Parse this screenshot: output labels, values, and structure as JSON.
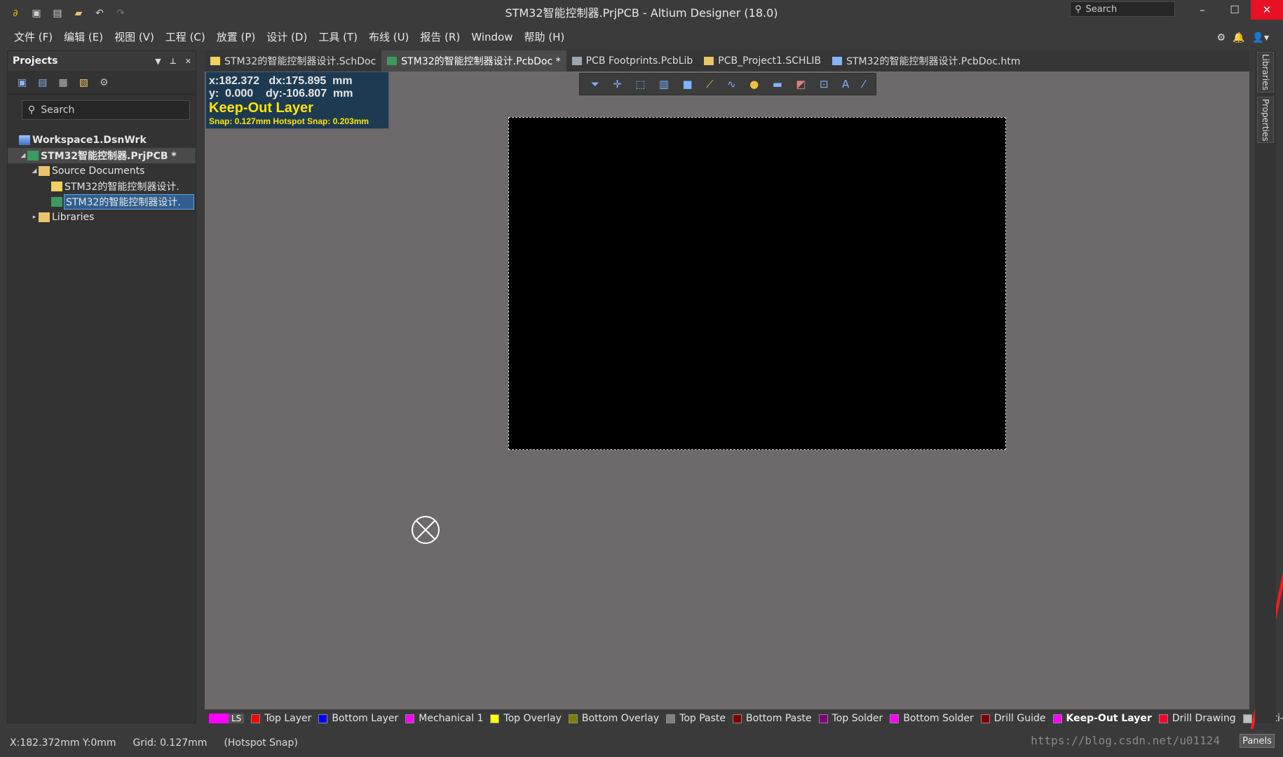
{
  "window": {
    "title": "STM32智能控制器.PrjPCB - Altium Designer (18.0)",
    "search_placeholder": "Search",
    "minimize": "–",
    "maximize": "☐",
    "close": "✕"
  },
  "menu": [
    "文件 (F)",
    "编辑 (E)",
    "视图 (V)",
    "工程 (C)",
    "放置 (P)",
    "设计 (D)",
    "工具 (T)",
    "布线 (U)",
    "报告 (R)",
    "Window",
    "帮助 (H)"
  ],
  "projects_panel": {
    "title": "Projects",
    "search_placeholder": "Search",
    "tree": [
      {
        "label": "Workspace1.DsnWrk",
        "level": 0
      },
      {
        "label": "STM32智能控制器.PrjPCB *",
        "level": 0
      },
      {
        "label": "Source Documents",
        "level": 1
      },
      {
        "label": "STM32的智能控制器设计.",
        "level": 2
      },
      {
        "label": "STM32的智能控制器设计.",
        "level": 2
      },
      {
        "label": "Libraries",
        "level": 1
      }
    ]
  },
  "tabs": [
    {
      "label": "STM32的智能控制器设计.SchDoc"
    },
    {
      "label": "STM32的智能控制器设计.PcbDoc *"
    },
    {
      "label": "PCB Footprints.PcbLib"
    },
    {
      "label": "PCB_Project1.SCHLIB"
    },
    {
      "label": "STM32的智能控制器设计.PcbDoc.htm"
    }
  ],
  "hud": {
    "line1": "x:182.372   dx:175.895  mm",
    "line2": "y:  0.000    dy:-106.807  mm",
    "layer": "Keep-Out Layer",
    "snap": "Snap: 0.127mm Hotspot Snap: 0.203mm"
  },
  "layers": {
    "ls_label": "LS",
    "items": [
      {
        "label": "Top Layer",
        "color": "#ff0000"
      },
      {
        "label": "Bottom Layer",
        "color": "#0000ff"
      },
      {
        "label": "Mechanical 1",
        "color": "#ff00ff"
      },
      {
        "label": "Top Overlay",
        "color": "#ffff00"
      },
      {
        "label": "Bottom Overlay",
        "color": "#808000"
      },
      {
        "label": "Top Paste",
        "color": "#808080"
      },
      {
        "label": "Bottom Paste",
        "color": "#800000"
      },
      {
        "label": "Top Solder",
        "color": "#800080"
      },
      {
        "label": "Bottom Solder",
        "color": "#ff00ff"
      },
      {
        "label": "Drill Guide",
        "color": "#800000"
      },
      {
        "label": "Keep-Out Layer",
        "color": "#ff00ff",
        "active": true
      },
      {
        "label": "Drill Drawing",
        "color": "#ff002a"
      },
      {
        "label": "Multi-Layer",
        "color": "#c0c0c0"
      }
    ]
  },
  "right_panels": [
    "Libraries",
    "Properties"
  ],
  "status": {
    "coords": "X:182.372mm Y:0mm",
    "grid": "Grid: 0.127mm",
    "snap": "(Hotspot Snap)",
    "panels": "Panels",
    "watermark": "https://blog.csdn.net/u01124"
  }
}
